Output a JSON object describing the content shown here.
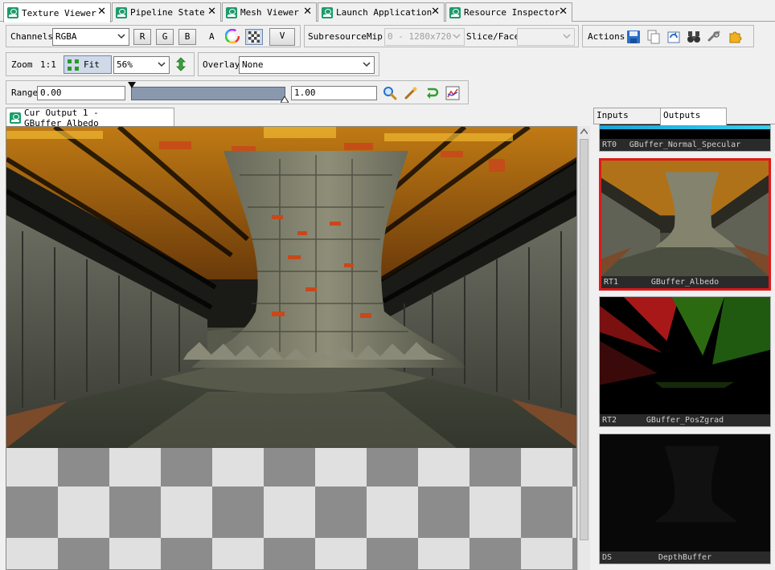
{
  "tabs": [
    {
      "label": "Texture Viewer",
      "active": true
    },
    {
      "label": "Pipeline State",
      "active": false
    },
    {
      "label": "Mesh Viewer",
      "active": false
    },
    {
      "label": "Launch Application",
      "active": false
    },
    {
      "label": "Resource Inspector",
      "active": false
    }
  ],
  "tab_close_glyph": "✕",
  "channels": {
    "label": "Channels",
    "value": "RGBA",
    "r": "R",
    "g": "G",
    "b": "B",
    "a": "A",
    "more_glyph": "V"
  },
  "subresource": {
    "label": "Subresource",
    "mip_label": "Mip",
    "mip_value": "0 - 1280x720",
    "slice_label": "Slice/Face",
    "slice_value": ""
  },
  "actions": {
    "label": "Actions"
  },
  "zoom": {
    "label": "Zoom",
    "one_to_one": "1:1",
    "fit_label": "Fit",
    "value": "56%"
  },
  "overlay": {
    "label": "Overlay",
    "value": "None"
  },
  "range": {
    "label": "Range",
    "min": "0.00",
    "max": "1.00",
    "min_fraction": 0.0,
    "max_fraction": 1.0
  },
  "viewer": {
    "tab_label": "Cur Output 1 - GBuffer_Albedo"
  },
  "side_tabs": [
    {
      "label": "Inputs",
      "active": false
    },
    {
      "label": "Outputs",
      "active": true
    }
  ],
  "outputs": [
    {
      "slot": "RT0",
      "name": "GBuffer_Normal_Specular",
      "selected": false
    },
    {
      "slot": "RT1",
      "name": "GBuffer_Albedo",
      "selected": true
    },
    {
      "slot": "RT2",
      "name": "GBuffer_PosZgrad",
      "selected": false
    },
    {
      "slot": "DS",
      "name": "DepthBuffer",
      "selected": false
    }
  ],
  "colors": {
    "selection_border": "#e01818",
    "tab_icon": "#1c9c6b",
    "range_bar": "#8a98ad"
  }
}
